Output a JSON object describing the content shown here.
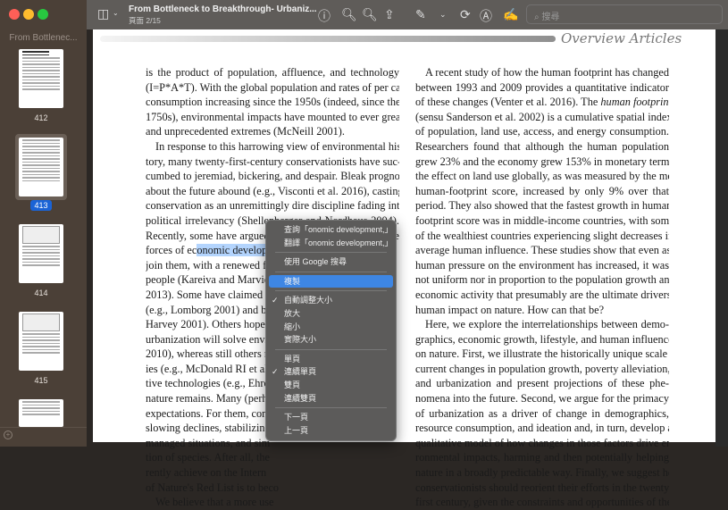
{
  "window": {
    "traffic_colors": [
      "#fe5f57",
      "#febc2e",
      "#28c840"
    ]
  },
  "sidebar": {
    "title": "From Bottlenec...",
    "pages": [
      {
        "label": "412"
      },
      {
        "label": "413",
        "selected": true
      },
      {
        "label": "414"
      },
      {
        "label": "415"
      }
    ]
  },
  "toolbar": {
    "title": "From Bottleneck to Breakthrough- Urbaniz...",
    "page": "頁面 2/15",
    "search_placeholder": "搜尋",
    "icons": [
      "sidebar-icon",
      "chevron-down-icon",
      "info-icon",
      "zoom-out-icon",
      "zoom-in-icon",
      "share-icon",
      "markup-pen-icon",
      "chevron-down-icon",
      "rotate-icon",
      "annotate-icon",
      "signature-icon"
    ]
  },
  "page": {
    "header": "Overview Articles",
    "left": [
      "is the product of population, affluence, and technology",
      "(I=P*A*T). With the global population and rates of per capita",
      "consumption increasing since the 1950s (indeed, since the",
      "1750s), environmental impacts have mounted to ever greater",
      "and unprecedented extremes (McNeill 2001).",
      "In response to this harrowing view of environmental his-",
      "tory, many twenty-first-century conservationists have suc-",
      "cumbed to jeremiad, bickering, and despair. Bleak prognoses",
      "about the future abound (e.g., Visconti et al. 2016), casting",
      "conservation as an unremittingly dire discipline fading into",
      "political irrelevancy (Shellenberger and Nordhaus 2004).",
      "Recently, some have argued that rather than opposing the",
      "forces of ec",
      "onomic developm",
      "join them, with a renewed f",
      "people (Kareiva and Marvier",
      "2013). Some have claimed th",
      "(e.g., Lomborg 2001) and bee",
      "Harvey 2001). Others hope",
      "urbanization will solve envir",
      "2010), whereas still others ma",
      "ies (e.g., McDonald RI et al. 2",
      "tive technologies (e.g., Ehren",
      "nature remains. Many (perha",
      "expectations. For them, cons",
      "slowing declines, stabilizing s",
      "managed situations, and sim",
      "tion of species. After all, the",
      "rently achieve on the Intern",
      "of Nature's Red List is to beco",
      "We believe that a more use"
    ],
    "right": [
      "A recent study of how the human footprint has changed",
      "between 1993 and 2009 provides a quantitative indicator",
      "of these changes (Venter et al. 2016). The human footprint",
      "(sensu Sanderson et al. 2002) is a cumulative spatial index",
      "of population, land use, access, and energy consumption.",
      "Researchers found that although the human population",
      "grew 23% and the economy grew 153% in monetary terms,",
      "the effect on land use globally, as was measured by the mean",
      "human-footprint score, increased by only 9% over that",
      "period. They also showed that the fastest growth in human-",
      "footprint score was in middle-income countries, with some",
      "of the wealthiest countries experiencing slight decreases in",
      "average human influence. These studies show that even as",
      "human pressure on the environment has increased, it was",
      "not uniform nor in proportion to the population growth and",
      "economic activity that presumably are the ultimate drivers of",
      "human impact on nature. How can that be?",
      "Here, we explore the interrelationships between demo-",
      "graphics, economic growth, lifestyle, and human influence",
      "on nature. First, we illustrate the historically unique scale of",
      "current changes in population growth, poverty alleviation,",
      "and urbanization and present projections of these phe-",
      "nomena into the future. Second, we argue for the primacy",
      "of urbanization as a driver of change in demographics,",
      "resource consumption, and ideation and, in turn, develop a",
      "qualitative model of how changes in those factors drive envi-",
      "ronmental impacts, harming and then potentially helping",
      "nature in a broadly predictable way. Finally, we suggest how",
      "conservationists should reorient their efforts in the twenty-",
      "first century, given the constraints and opportunities of the"
    ]
  },
  "context_menu": {
    "groups": [
      [
        {
          "label": "查詢「onomic development,」"
        },
        {
          "label": "翻譯「onomic development,」"
        }
      ],
      [
        {
          "label": "使用 Google 搜尋"
        }
      ],
      [
        {
          "label": "複製",
          "highlighted": true
        }
      ],
      [
        {
          "label": "自動調整大小",
          "checked": true
        },
        {
          "label": "放大"
        },
        {
          "label": "縮小"
        },
        {
          "label": "實際大小"
        }
      ],
      [
        {
          "label": "單頁"
        },
        {
          "label": "連續單頁",
          "checked": true
        },
        {
          "label": "雙頁"
        },
        {
          "label": "連續雙頁"
        }
      ],
      [
        {
          "label": "下一頁"
        },
        {
          "label": "上一頁"
        }
      ]
    ],
    "highlight_color": "#3e86e3"
  }
}
